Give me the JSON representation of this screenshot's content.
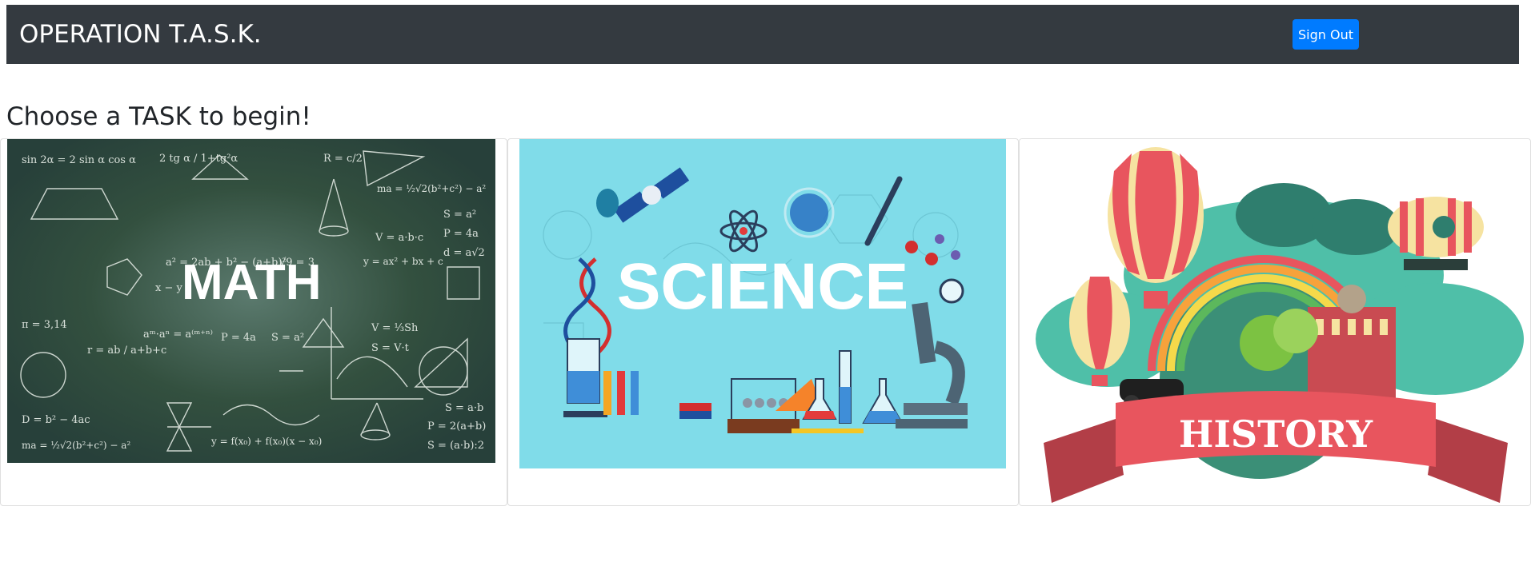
{
  "navbar": {
    "brand": "OPERATION T.A.S.K.",
    "sign_out_label": "Sign Out",
    "bg_color": "#343a40",
    "button_color": "#007bff"
  },
  "main": {
    "heading": "Choose a TASK to begin!"
  },
  "tasks": [
    {
      "label": "MATH",
      "image_colors": {
        "board": "#2f4a40",
        "chalk": "#ffffff"
      },
      "formulas": [
        "sin 2α = 2 sin α cos α",
        "2 tg α / 1+tg²α",
        "R = c/2",
        "ma = ½√2(b²+c²) − a²",
        "S = a²",
        "P = 4a",
        "V = a·b·c",
        "d = a√2",
        "a² = 2ab + b² − (a+b)²",
        "√9 = 3",
        "y = ax² + bx + c",
        "x − y",
        "π = 3,14",
        "r = ab / a+b+c",
        "aᵐ·aⁿ = a⁽ᵐ⁺ⁿ⁾",
        "P = 4a",
        "S = a²",
        "V = ⅓Sh",
        "S = V·t",
        "D = b² − 4ac",
        "y = f(x₀) + f(x₀)(x − x₀)",
        "S = a·b",
        "P = 2(a+b)",
        "S = (a·b):2",
        "ma = ½√2(b²+c²) − a²"
      ]
    },
    {
      "label": "SCIENCE",
      "image_colors": {
        "bg": "#7fdbe8",
        "text": "#ffffff"
      }
    },
    {
      "label": "HISTORY",
      "image_colors": {
        "banner": "#e8555e",
        "text": "#ffffff"
      }
    }
  ]
}
